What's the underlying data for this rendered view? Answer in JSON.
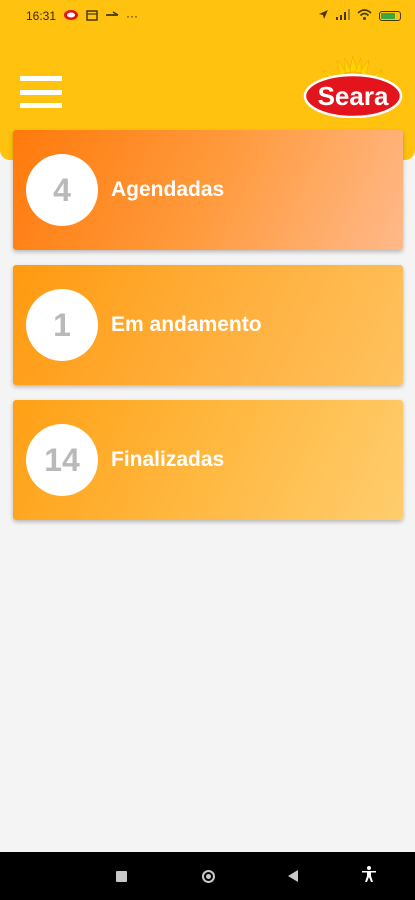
{
  "status_bar": {
    "time": "16:31",
    "dots": "···"
  },
  "header": {
    "logo_text": "Seara",
    "colors": {
      "header_bg": "#ffc20e",
      "logo_red": "#e3141b"
    }
  },
  "cards": [
    {
      "count": "4",
      "label": "Agendadas"
    },
    {
      "count": "1",
      "label": "Em andamento"
    },
    {
      "count": "14",
      "label": "Finalizadas"
    }
  ],
  "icons": {
    "menu": "hamburger-menu-icon",
    "nav_recents": "square-icon",
    "nav_home": "circle-icon",
    "nav_back": "triangle-back-icon",
    "nav_accessibility": "accessibility-icon"
  }
}
